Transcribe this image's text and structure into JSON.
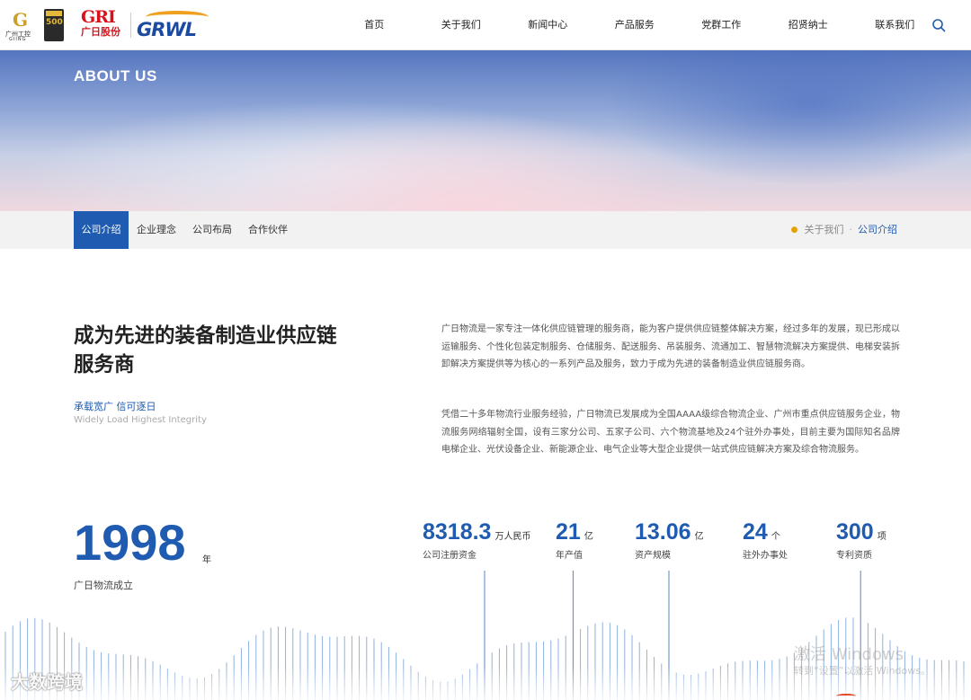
{
  "header": {
    "logo_giing_cn": "广州工控",
    "logo_giing_en": "GIING",
    "logo_500": "500",
    "logo_gri": "GRI",
    "logo_gri_cn": "广日股份",
    "logo_grwl": "GRWL",
    "nav": [
      "首页",
      "关于我们",
      "新闻中心",
      "产品服务",
      "党群工作",
      "招贤纳士",
      "联系我们"
    ]
  },
  "banner": {
    "title": "ABOUT US"
  },
  "subnav": {
    "tabs": [
      "公司介绍",
      "企业理念",
      "公司布局",
      "合作伙伴"
    ],
    "breadcrumb": [
      "关于我们",
      "公司介绍"
    ]
  },
  "main": {
    "headline": "成为先进的装备制造业供应链服务商",
    "slogan_cn": "承载宽广 信可逐日",
    "slogan_en": "Widely Load Highest Integrity",
    "para1": "广日物流是一家专注一体化供应链管理的服务商，能为客户提供供应链整体解决方案，经过多年的发展，现已形成以运输服务、个性化包装定制服务、仓储服务、配送服务、吊装服务、流通加工、智慧物流解决方案提供、电梯安装拆卸解决方案提供等为核心的一系列产品及服务，致力于成为先进的装备制造业供应链服务商。",
    "para2": "凭借二十多年物流行业服务经验，广日物流已发展成为全国AAAA级综合物流企业、广州市重点供应链服务企业，物流服务网络辐射全国，设有三家分公司、五家子公司、六个物流基地及24个驻外办事处，目前主要为国际知名品牌电梯企业、光伏设备企业、新能源企业、电气企业等大型企业提供一站式供应链解决方案及综合物流服务。"
  },
  "stats": {
    "year": {
      "value": "1998",
      "unit": "年",
      "label": "广日物流成立"
    },
    "items": [
      {
        "value": "8318.3",
        "unit": "万人民币",
        "label": "公司注册资金"
      },
      {
        "value": "21",
        "unit": "亿",
        "label": "年产值"
      },
      {
        "value": "13.06",
        "unit": "亿",
        "label": "资产规模"
      },
      {
        "value": "24",
        "unit": "个",
        "label": "驻外办事处"
      },
      {
        "value": "300",
        "unit": "项",
        "label": "专利资质"
      }
    ]
  },
  "watermarks": {
    "logo": "大数跨境",
    "win_title": "激活 Windows",
    "win_sub": "转到“设置”以激活 Windows。"
  },
  "colors": {
    "accent": "#1f5bb0",
    "brand_red": "#d8121d",
    "gold": "#e5a100"
  }
}
